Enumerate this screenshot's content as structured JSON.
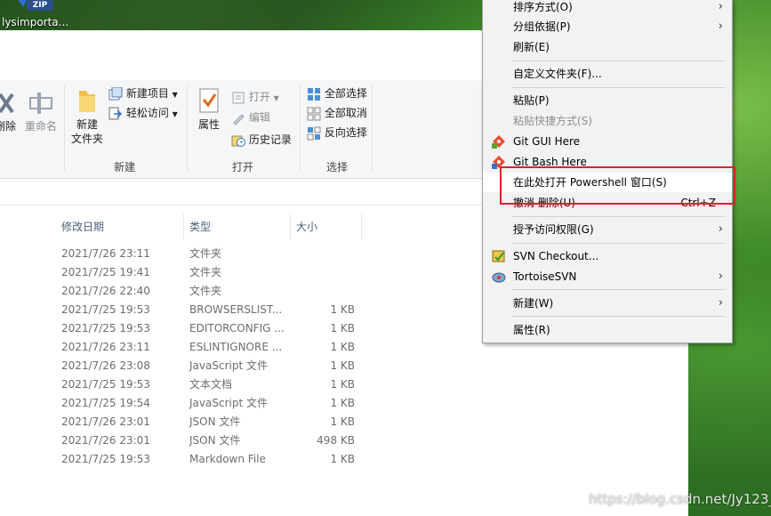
{
  "desktop": {
    "icon_badge": "ZIP",
    "icon_label": "lysimporta..."
  },
  "ribbon": {
    "organize": {
      "delete_label": "删除",
      "rename_label": "重命名"
    },
    "new_group": {
      "new_folder_label_line1": "新建",
      "new_folder_label_line2": "文件夹",
      "new_item_label": "新建项目",
      "easy_access_label": "轻松访问",
      "group_label": "新建"
    },
    "open_group": {
      "properties_label": "属性",
      "open_label": "打开",
      "edit_label": "编辑",
      "history_label": "历史记录",
      "group_label": "打开"
    },
    "select_group": {
      "select_all_label": "全部选择",
      "select_none_label": "全部取消",
      "invert_label": "反向选择",
      "group_label": "选择"
    }
  },
  "file_list": {
    "headers": {
      "date": "修改日期",
      "type": "类型",
      "size": "大小"
    },
    "rows": [
      {
        "date": "2021/7/26 23:11",
        "type": "文件夹",
        "size": ""
      },
      {
        "date": "2021/7/25 19:41",
        "type": "文件夹",
        "size": ""
      },
      {
        "date": "2021/7/26 22:40",
        "type": "文件夹",
        "size": ""
      },
      {
        "date": "2021/7/25 19:53",
        "type": "BROWSERSLIST...",
        "size": "1 KB"
      },
      {
        "date": "2021/7/25 19:53",
        "type": "EDITORCONFIG ...",
        "size": "1 KB"
      },
      {
        "date": "2021/7/26 23:11",
        "type": "ESLINTIGNORE ...",
        "size": "1 KB"
      },
      {
        "date": "2021/7/26 23:08",
        "type": "JavaScript 文件",
        "size": "1 KB"
      },
      {
        "date": "2021/7/25 19:53",
        "type": "文本文档",
        "size": "1 KB"
      },
      {
        "date": "2021/7/25 19:54",
        "type": "JavaScript 文件",
        "size": "1 KB"
      },
      {
        "date": "2021/7/26 23:01",
        "type": "JSON 文件",
        "size": "1 KB"
      },
      {
        "date": "2021/7/26 23:01",
        "type": "JSON 文件",
        "size": "498 KB"
      },
      {
        "date": "2021/7/25 19:53",
        "type": "Markdown File",
        "size": "1 KB"
      }
    ]
  },
  "context_menu": {
    "sort_by": "排序方式(O)",
    "group_by": "分组依据(P)",
    "refresh": "刷新(E)",
    "customize": "自定义文件夹(F)...",
    "paste": "粘贴(P)",
    "paste_shortcut": "粘贴快捷方式(S)",
    "git_gui": "Git GUI Here",
    "git_bash": "Git Bash Here",
    "powershell": "在此处打开 Powershell 窗口(S)",
    "undo_delete": "撤消 删除(U)",
    "undo_shortcut": "Ctrl+Z",
    "grant_access": "授予访问权限(G)",
    "svn_checkout": "SVN Checkout...",
    "tortoise_svn": "TortoiseSVN",
    "new": "新建(W)",
    "properties": "属性(R)"
  },
  "watermark": "https://blog.csdn.net/Jy123_",
  "colors": {
    "highlight_box": "#e0202a",
    "menu_bg": "#f2f2f2",
    "ribbon_bg": "#f5f6f7"
  }
}
